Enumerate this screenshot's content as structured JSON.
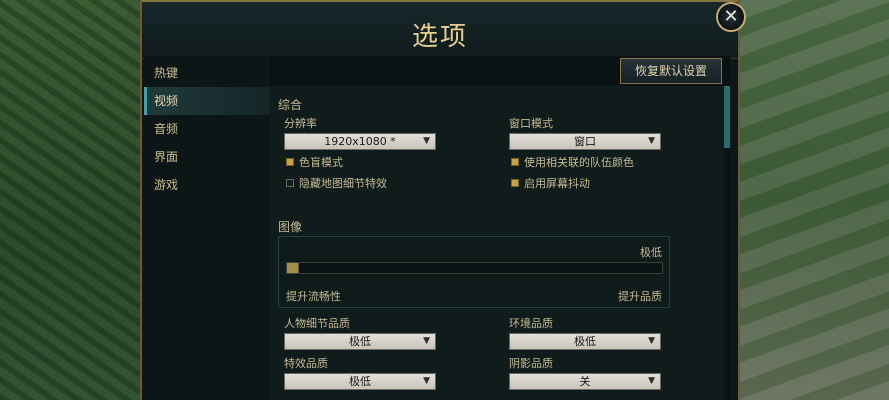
{
  "window": {
    "title": "选项",
    "close_symbol": "✕",
    "close_icon": "close-icon"
  },
  "sidebar": {
    "items": [
      {
        "label": "热键",
        "active": false
      },
      {
        "label": "视频",
        "active": true
      },
      {
        "label": "音频",
        "active": false
      },
      {
        "label": "界面",
        "active": false
      },
      {
        "label": "游戏",
        "active": false
      }
    ]
  },
  "toolbar": {
    "reset_label": "恢复默认设置"
  },
  "general": {
    "heading": "综合",
    "resolution_label": "分辨率",
    "resolution_value": "1920x1080 *",
    "window_mode_label": "窗口模式",
    "window_mode_value": "窗口",
    "colorblind_label": "色盲模式",
    "colorblind_checked": true,
    "hide_detail_label": "隐藏地图细节特效",
    "hide_detail_checked": false,
    "team_colors_label": "使用相关联的队伍颜色",
    "team_colors_checked": true,
    "screen_shake_label": "启用屏幕抖动",
    "screen_shake_checked": true
  },
  "graphics": {
    "heading": "图像",
    "preset_value": "极低",
    "slider_min_label": "提升流畅性",
    "slider_max_label": "提升品质",
    "slider_level": 0
  },
  "quality": {
    "character_label": "人物细节品质",
    "character_value": "极低",
    "environment_label": "环境品质",
    "environment_value": "极低",
    "effects_label": "特效品质",
    "effects_value": "极低",
    "shadow_label": "阴影品质",
    "shadow_value": "关"
  },
  "colors": {
    "accent_gold": "#c8aa6e",
    "accent_teal": "#3fa1a1",
    "text": "#c7bb94"
  },
  "select_caret": "▼"
}
